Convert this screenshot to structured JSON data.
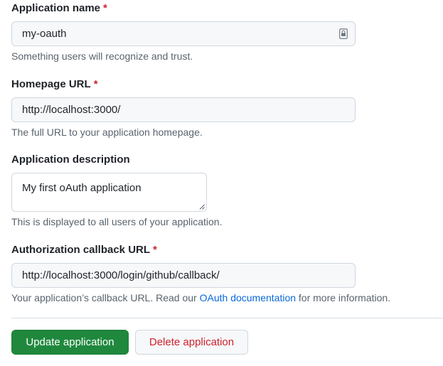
{
  "fields": {
    "app_name": {
      "label": "Application name",
      "required_mark": "*",
      "value": "my-oauth",
      "hint": "Something users will recognize and trust."
    },
    "homepage_url": {
      "label": "Homepage URL",
      "required_mark": "*",
      "value": "http://localhost:3000/",
      "hint": "The full URL to your application homepage."
    },
    "description": {
      "label": "Application description",
      "value": "My first oAuth application",
      "hint": "This is displayed to all users of your application."
    },
    "callback_url": {
      "label": "Authorization callback URL",
      "required_mark": "*",
      "value": "http://localhost:3000/login/github/callback/",
      "hint_before": "Your application’s callback URL. Read our",
      "hint_link": "OAuth documentation",
      "hint_after": "for more information."
    }
  },
  "actions": {
    "update_label": "Update application",
    "delete_label": "Delete application"
  },
  "icons": {
    "password_manager": "password-manager-icon",
    "resize_handle": "resize-handle-icon"
  },
  "colors": {
    "required": "#cf222e",
    "primary_button": "#1f883d",
    "danger_text": "#cf222e",
    "link": "#0969da"
  }
}
